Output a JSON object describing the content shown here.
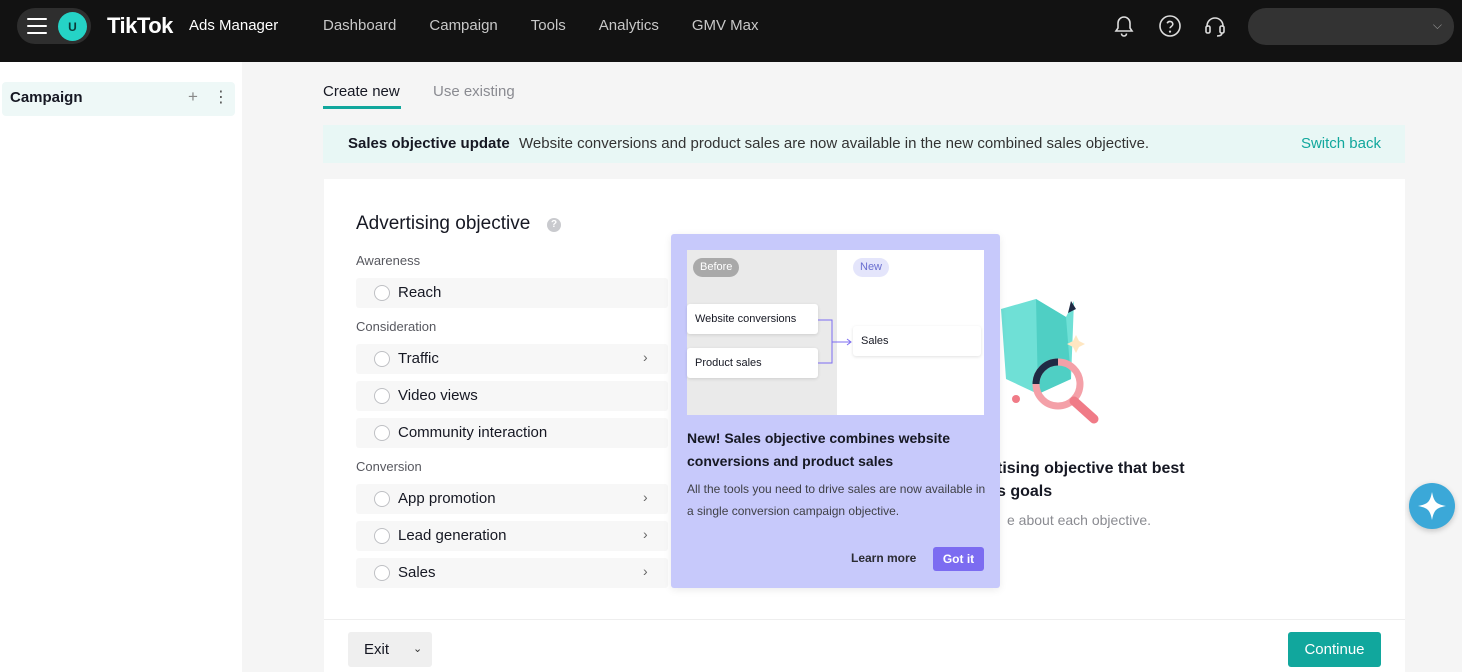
{
  "topbar": {
    "avatar_initial": "U",
    "brand": "TikTok",
    "brand_sub": "Ads Manager",
    "nav": [
      "Dashboard",
      "Campaign",
      "Tools",
      "Analytics",
      "GMV Max"
    ]
  },
  "sidebar": {
    "campaign_label": "Campaign",
    "plus": "+",
    "more": "⋮"
  },
  "tabs": {
    "create_new": "Create new",
    "use_existing": "Use existing"
  },
  "banner": {
    "title": "Sales objective update",
    "message": "Website conversions and product sales are now available in the new combined sales objective.",
    "switch_back": "Switch back"
  },
  "objective": {
    "title": "Advertising objective",
    "help": "?",
    "groups": {
      "awareness": "Awareness",
      "consideration": "Consideration",
      "conversion": "Conversion"
    },
    "items": {
      "reach": "Reach",
      "traffic": "Traffic",
      "video_views": "Video views",
      "community": "Community interaction",
      "app_promotion": "App promotion",
      "lead_generation": "Lead generation",
      "sales": "Sales"
    },
    "arrow": "›"
  },
  "right_panel": {
    "title_line1": "tising objective that best",
    "title_line2": "s goals",
    "subtitle": "e about each objective."
  },
  "popover": {
    "badge_before": "Before",
    "badge_new": "New",
    "card_website": "Website conversions",
    "card_product": "Product sales",
    "card_sales": "Sales",
    "title": "New! Sales objective combines website conversions and product sales",
    "body": "All the tools you need to drive sales are now available in a single conversion campaign objective.",
    "learn_more": "Learn more",
    "got_it": "Got it"
  },
  "footer": {
    "exit": "Exit",
    "exit_chevron": "⌄",
    "continue": "Continue"
  },
  "colors": {
    "accent": "#11a79d",
    "popover_bg": "#c7c9fb",
    "got_it": "#7c6cf1"
  },
  "icons": [
    "menu-icon",
    "bell-icon",
    "help-icon",
    "headset-icon",
    "chevron-down-icon",
    "assistant-icon"
  ]
}
